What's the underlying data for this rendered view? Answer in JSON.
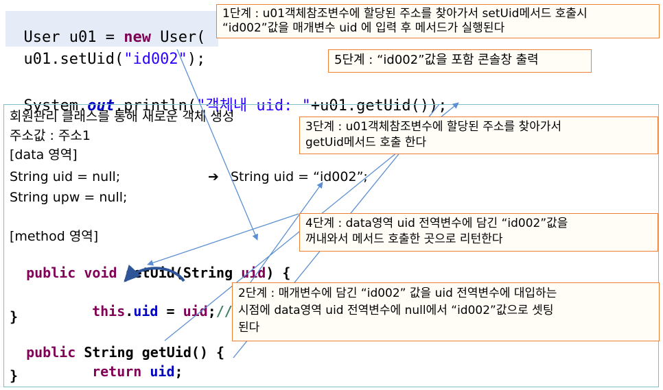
{
  "code": {
    "line1_a": "User u01 = ",
    "line1_kw": "new",
    "line1_b": " User(",
    "line2_a": "u01.setUid(",
    "line2_str": "\"id002\"",
    "line2_b": ");",
    "line3_a": "System.",
    "line3_out": "out",
    "line3_b": ".println(",
    "line3_str": "\"객체내 uid: \"",
    "line3_c": "+u01.getUid());"
  },
  "panel": {
    "title": "회원관리 클래스를 통해 새로운 객체 생성",
    "address": "주소값 : 주소1",
    "data_area": "[data 영역]",
    "field_uid": "String uid = null;",
    "arrow_glyph": "➔",
    "field_uid_after": "String uid = “id002”;",
    "field_upw": "String upw = null;",
    "method_area": "[method 영역]",
    "setuid_kw1": "public",
    "setuid_kw2": "void",
    "setuid_sig": " setUid(String ",
    "setuid_param": "uid",
    "setuid_end": ") {",
    "assign_kw": "this",
    "assign_dot": ".",
    "assign_fld": "uid",
    "assign_eq": " = ",
    "assign_val": "uid",
    "assign_semi": ";",
    "assign_cmt": "//",
    "brace1": "}",
    "getuid_kw": "public",
    "getuid_sig": " String getUid() {",
    "return_kw": "return",
    "return_val": " uid",
    "return_semi": ";",
    "brace2": "}"
  },
  "steps": {
    "step1_line1": "1단계 : u01객체참조변수에 할당된 주소를 찾아가서 setUid메서드 호출시",
    "step1_line2": "“id002”값을 매개변수 uid 에 입력 후 메서드가 실행된다",
    "step5": "5단계 : “id002”값을 포함 콘솔창 출력",
    "step3_line1": "3단계 : u01객체참조변수에 할당된 주소를 찾아가서",
    "step3_line2": "getUid메서드 호출 한다",
    "step4_line1": "4단계 : data영역 uid 전역변수에 담긴 “id002”값을",
    "step4_line2": "꺼내와서 메서드 호출한 곳으로 리턴한다",
    "step2_line1": "2단계 : 매개변수에 담긴 “id002” 값을 uid 전역변수에 대입하는",
    "step2_line2": "시점에 data영역 uid 전역변수에 null에서 “id002”값으로 셋팅",
    "step2_line3": "된다"
  },
  "colors": {
    "box_border": "#ed7d31",
    "panel_border": "#7dbfc7",
    "keyword": "#7f0055",
    "string": "#2a00ff",
    "field": "#0000c0",
    "arrow": "#5b8fd1",
    "curve_arrow": "#2e5597"
  }
}
